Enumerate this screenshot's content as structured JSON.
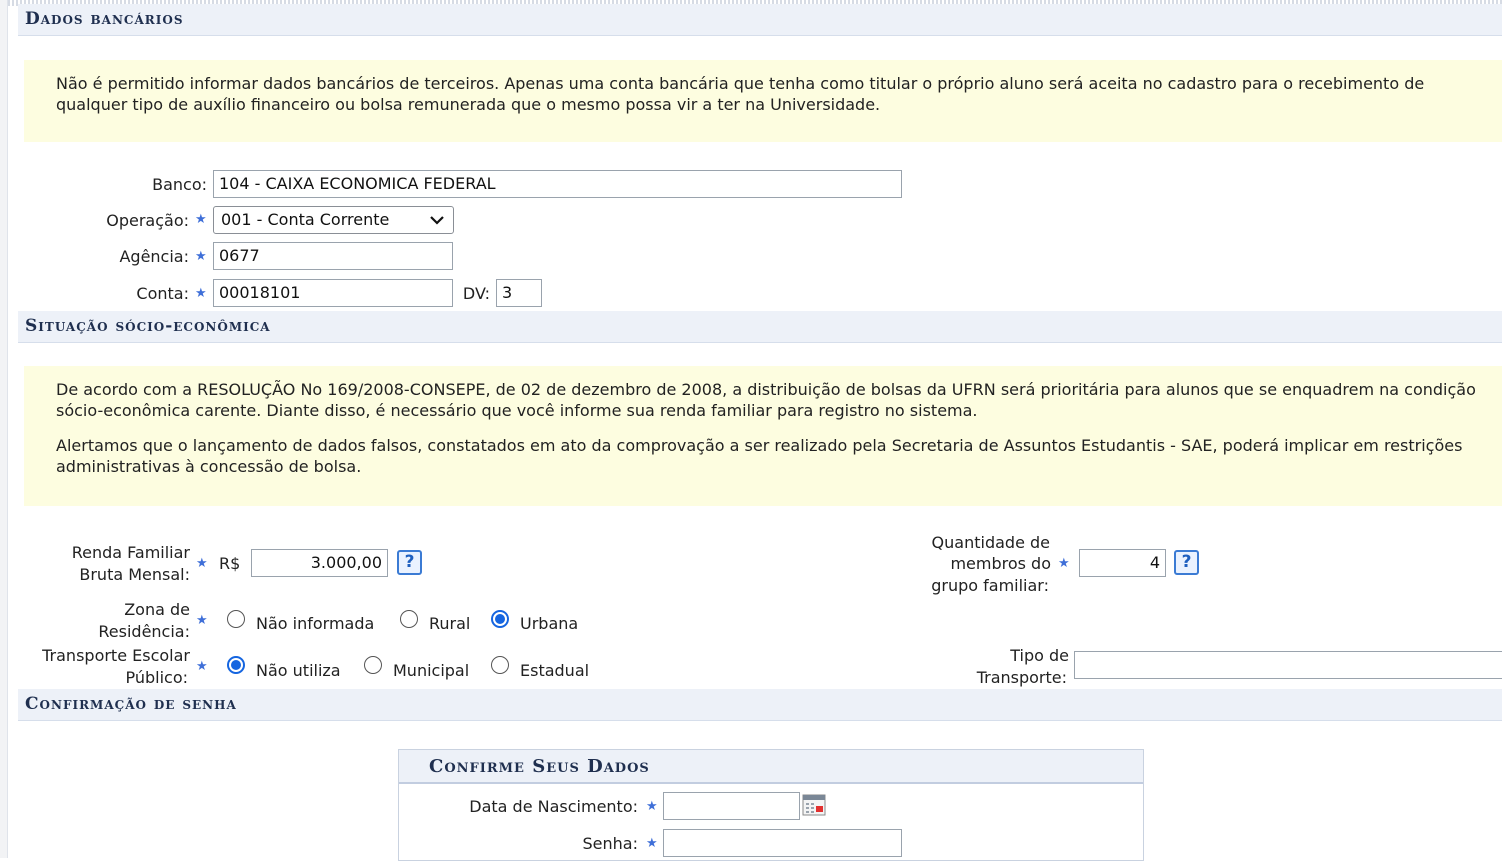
{
  "sections": {
    "bank": "Dados bancários",
    "socio": "Situação sócio-econômica",
    "password": "Confirmação de senha"
  },
  "bank_notice": "Não é permitido informar dados bancários de terceiros. Apenas uma conta bancária que tenha como titular o próprio aluno será aceita no cadastro para o recebimento de qualquer tipo de auxílio financeiro ou bolsa remunerada que o mesmo possa vir a ter na Universidade.",
  "bank_form": {
    "banco_label": "Banco:",
    "banco_value": "104 - CAIXA ECONOMICA FEDERAL",
    "operacao_label": "Operação:",
    "operacao_value": "001 - Conta Corrente",
    "agencia_label": "Agência:",
    "agencia_value": "0677",
    "conta_label": "Conta:",
    "conta_value": "00018101",
    "dv_label": "DV:",
    "dv_value": "3"
  },
  "socio_notice": {
    "p1": "De acordo com a RESOLUÇÃO No 169/2008-CONSEPE, de 02 de dezembro de 2008, a distribuição de bolsas da UFRN será prioritária para alunos que se enquadrem na condição sócio-econômica carente. Diante disso, é necessário que você informe sua renda familiar para registro no sistema.",
    "p2": "Alertamos que o lançamento de dados falsos, constatados em ato da comprovação a ser realizado pela Secretaria de Assuntos Estudantis - SAE, poderá implicar em restrições administrativas à concessão de bolsa."
  },
  "socio_form": {
    "renda_label_1": "Renda Familiar",
    "renda_label_2": "Bruta Mensal:",
    "currency": "R$",
    "renda_value": "3.000,00",
    "help_glyph": "?",
    "membros_label_1": "Quantidade de",
    "membros_label_2": "membros do",
    "membros_label_3": "grupo familiar:",
    "membros_value": "4",
    "zona_label_1": "Zona de",
    "zona_label_2": "Residência:",
    "zona_options": [
      "Não informada",
      "Rural",
      "Urbana"
    ],
    "zona_selected": "Urbana",
    "transporte_label_1": "Transporte Escolar",
    "transporte_label_2": "Público:",
    "transporte_options": [
      "Não utiliza",
      "Municipal",
      "Estadual"
    ],
    "transporte_selected": "Não utiliza",
    "tipo_label_1": "Tipo de",
    "tipo_label_2": "Transporte:",
    "tipo_value": ""
  },
  "confirm_box": {
    "title": "Confirme Seus Dados",
    "nascimento_label": "Data de Nascimento:",
    "nascimento_value": "",
    "senha_label": "Senha:",
    "senha_value": ""
  },
  "required_glyph": "★",
  "colors": {
    "section_bg": "#edf1f8",
    "notice_bg": "#fdfde0",
    "accent": "#1565e0",
    "required": "#3f6fd8"
  },
  "icons": [
    "required-star-icon",
    "chevron-down-icon",
    "help-icon",
    "calendar-icon"
  ]
}
